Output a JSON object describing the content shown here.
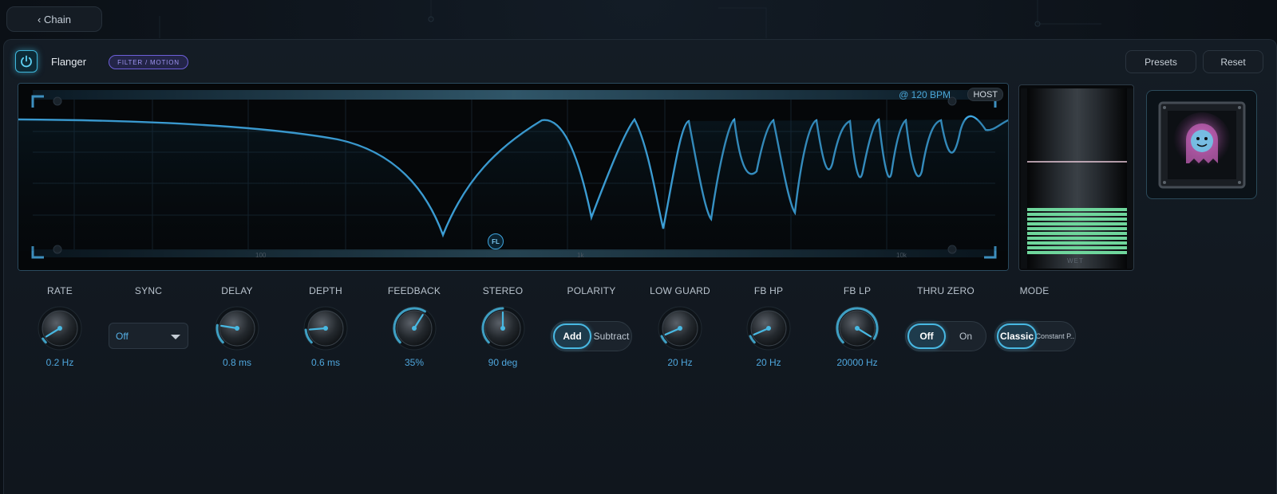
{
  "nav": {
    "back_label": "‹ Chain"
  },
  "header": {
    "title": "Flanger",
    "badge": "FILTER / MOTION",
    "presets_label": "Presets",
    "reset_label": "Reset"
  },
  "graph": {
    "bpm_label": "@ 120 BPM",
    "host_label": "HOST",
    "axis_labels": [
      "100",
      "1k",
      "10k"
    ],
    "marker_label": "FL"
  },
  "meter": {
    "label": "WET",
    "level": 0.3
  },
  "controls": {
    "rate": {
      "label": "RATE",
      "value": "0.2 Hz",
      "amount": 0.05
    },
    "sync": {
      "label": "SYNC",
      "value": "Off"
    },
    "delay": {
      "label": "DELAY",
      "value": "0.8 ms",
      "amount": 0.2
    },
    "depth": {
      "label": "DEPTH",
      "value": "0.6 ms",
      "amount": 0.15
    },
    "feedback": {
      "label": "FEEDBACK",
      "value": "35%",
      "amount": 0.62
    },
    "stereo": {
      "label": "STEREO",
      "value": "90 deg",
      "amount": 0.5
    },
    "polarity": {
      "label": "POLARITY",
      "options": [
        "Add",
        "Subtract"
      ],
      "selected": "Add"
    },
    "low_guard": {
      "label": "LOW GUARD",
      "value": "20 Hz",
      "amount": 0.08
    },
    "fb_hp": {
      "label": "FB HP",
      "value": "20 Hz",
      "amount": 0.08
    },
    "fb_lp": {
      "label": "FB LP",
      "value": "20000 Hz",
      "amount": 0.95
    },
    "thru_zero": {
      "label": "THRU ZERO",
      "options": [
        "Off",
        "On"
      ],
      "selected": "Off"
    },
    "mode": {
      "label": "MODE",
      "options": [
        "Classic",
        "Constant P..."
      ],
      "selected": "Classic"
    }
  },
  "colors": {
    "accent": "#48b8e2",
    "value_text": "#4ea6dc",
    "badge": "#6d5fd8",
    "meter_fill": "#6fd69c"
  },
  "icons": {
    "power": "power-icon",
    "caret": "chevron-down-icon",
    "art": "ghost-icon"
  }
}
